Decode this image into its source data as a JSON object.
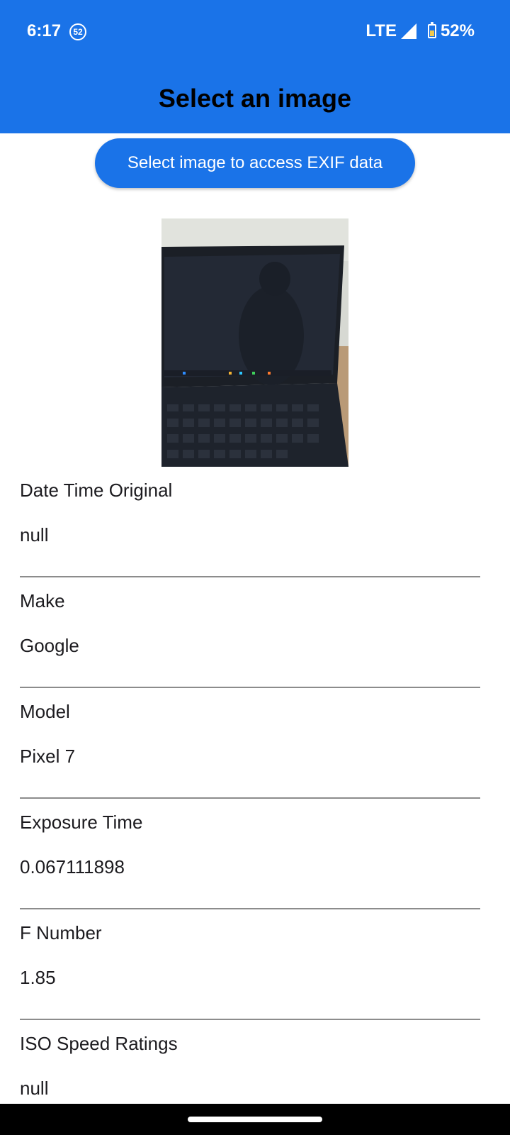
{
  "status_bar": {
    "time": "6:17",
    "notification_count": "52",
    "network": "LTE",
    "battery": "52%"
  },
  "app_bar": {
    "title": "Select an image"
  },
  "select_button": {
    "label": "Select image to access EXIF data"
  },
  "preview": {
    "icon": "laptop-photo"
  },
  "exif": [
    {
      "label": "Date Time Original",
      "value": "null"
    },
    {
      "label": "Make",
      "value": "Google"
    },
    {
      "label": "Model",
      "value": "Pixel 7"
    },
    {
      "label": "Exposure Time",
      "value": "0.067111898"
    },
    {
      "label": "F Number",
      "value": "1.85"
    },
    {
      "label": "ISO Speed Ratings",
      "value": "null"
    }
  ],
  "colors": {
    "primary": "#1a73e8",
    "divider": "#8c8c8c"
  }
}
